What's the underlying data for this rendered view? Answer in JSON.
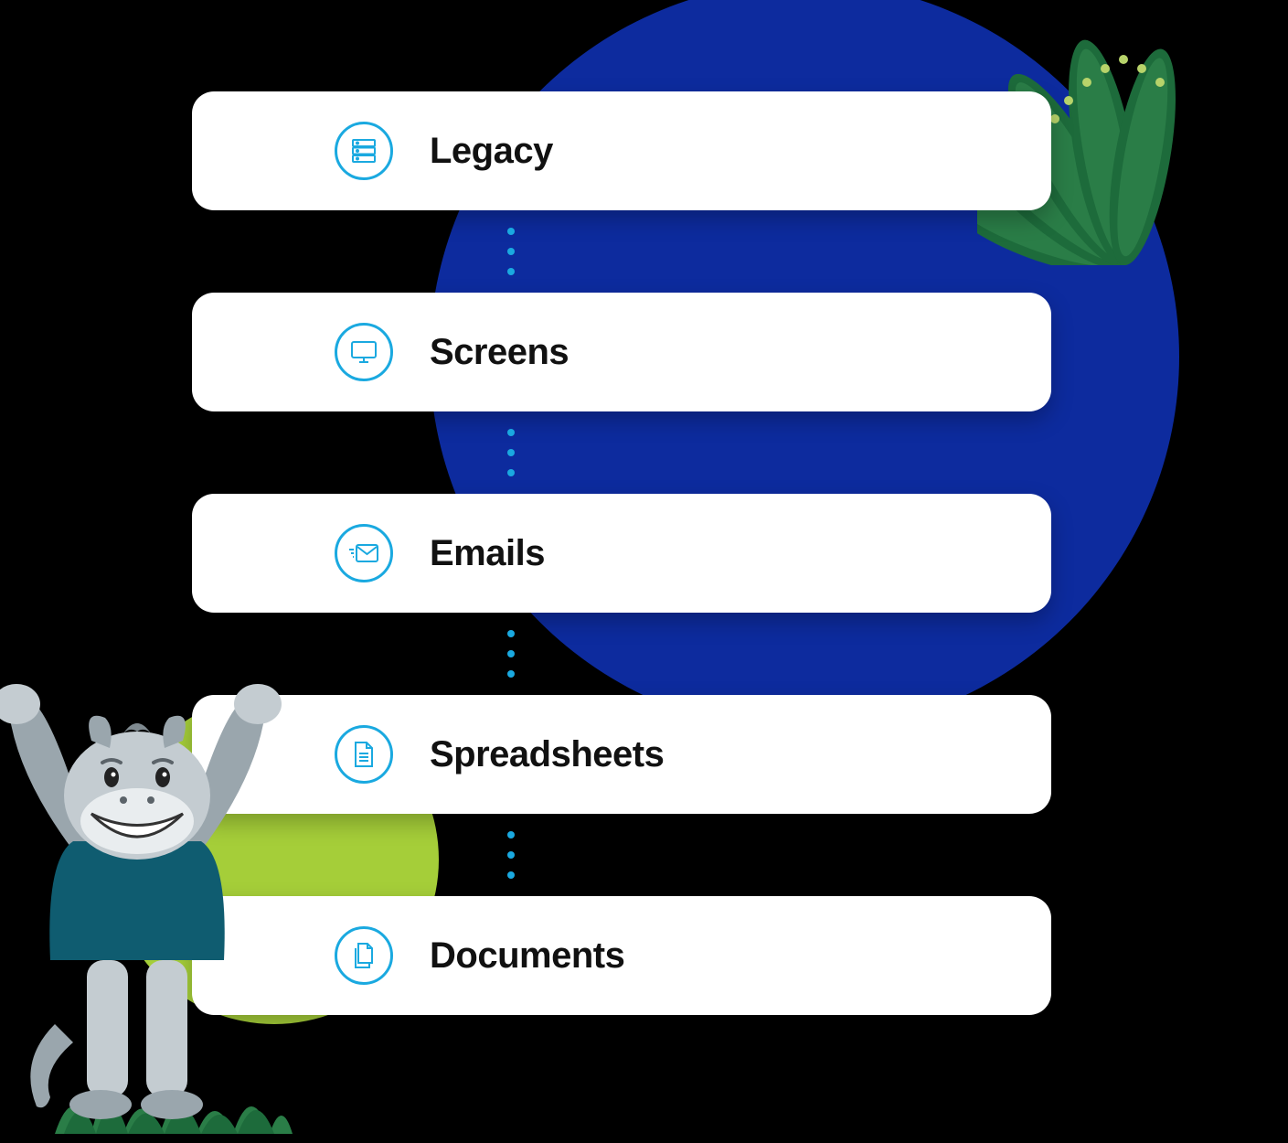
{
  "cards": [
    {
      "icon": "server-icon",
      "label": "Legacy"
    },
    {
      "icon": "monitor-icon",
      "label": "Screens"
    },
    {
      "icon": "email-icon",
      "label": "Emails"
    },
    {
      "icon": "file-icon",
      "label": "Spreadsheets"
    },
    {
      "icon": "documents-icon",
      "label": "Documents"
    }
  ],
  "colors": {
    "accent": "#1aa9e0",
    "blue_bg": "#0d2b9e",
    "green_bg": "#a5ce39"
  }
}
